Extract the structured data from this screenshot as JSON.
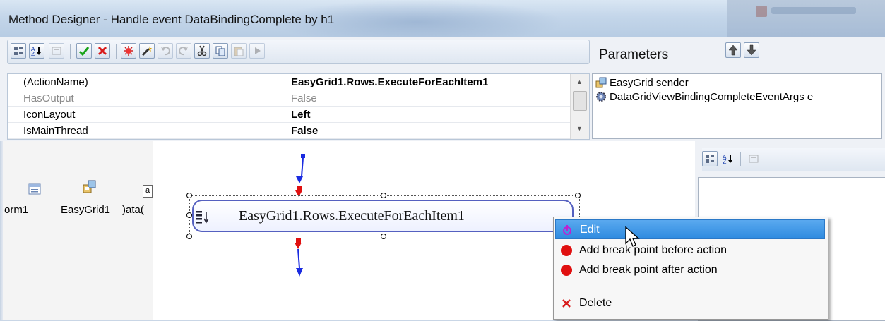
{
  "window": {
    "title": "Method Designer - Handle event DataBindingComplete by h1"
  },
  "toolbar": {
    "buttons": [
      {
        "icon": "categorized-icon"
      },
      {
        "icon": "sort-az-icon"
      },
      {
        "icon": "property-pages-icon"
      },
      {
        "icon": "ok-check-icon"
      },
      {
        "icon": "cancel-x-icon"
      },
      {
        "icon": "debug-icon"
      },
      {
        "icon": "magic-wand-icon"
      },
      {
        "icon": "undo-icon"
      },
      {
        "icon": "redo-icon"
      },
      {
        "icon": "cut-icon"
      },
      {
        "icon": "copy-icon"
      },
      {
        "icon": "paste-icon"
      },
      {
        "icon": "run-icon"
      }
    ]
  },
  "properties": [
    {
      "name": "(ActionName)",
      "value": "EasyGrid1.Rows.ExecuteForEachItem1",
      "bold": true,
      "grey": false
    },
    {
      "name": "HasOutput",
      "value": "False",
      "bold": false,
      "grey": true
    },
    {
      "name": "IconLayout",
      "value": "Left",
      "bold": true,
      "grey": false
    },
    {
      "name": "IsMainThread",
      "value": "False",
      "bold": true,
      "grey": false
    }
  ],
  "parameters": {
    "label": "Parameters",
    "items": [
      {
        "text": "EasyGrid sender",
        "icon": "component-icon"
      },
      {
        "text": "DataGridViewBindingCompleteEventArgs e",
        "icon": "gear-icon"
      }
    ]
  },
  "components": [
    {
      "label": "orm1",
      "icon": "form-icon"
    },
    {
      "label": "EasyGrid1",
      "icon": "grid-icon"
    },
    {
      "label": ")ata(",
      "icon": "data-icon"
    }
  ],
  "action": {
    "label": "EasyGrid1.Rows.ExecuteForEachItem1"
  },
  "context_menu": {
    "items": [
      {
        "label": "Edit",
        "icon": "edit-icon",
        "highlighted": true
      },
      {
        "label": "Add break point before action",
        "icon": "breakpoint-icon",
        "highlighted": false
      },
      {
        "label": "Add break point after action",
        "icon": "breakpoint-icon",
        "highlighted": false
      },
      {
        "label": "Delete",
        "icon": "delete-x-icon",
        "highlighted": false
      }
    ]
  },
  "colors": {
    "accent": "#2f8be0",
    "node_border": "#5560c0",
    "breakpoint": "#e01010",
    "link_blue": "#1a2be0",
    "link_red": "#e01010"
  }
}
